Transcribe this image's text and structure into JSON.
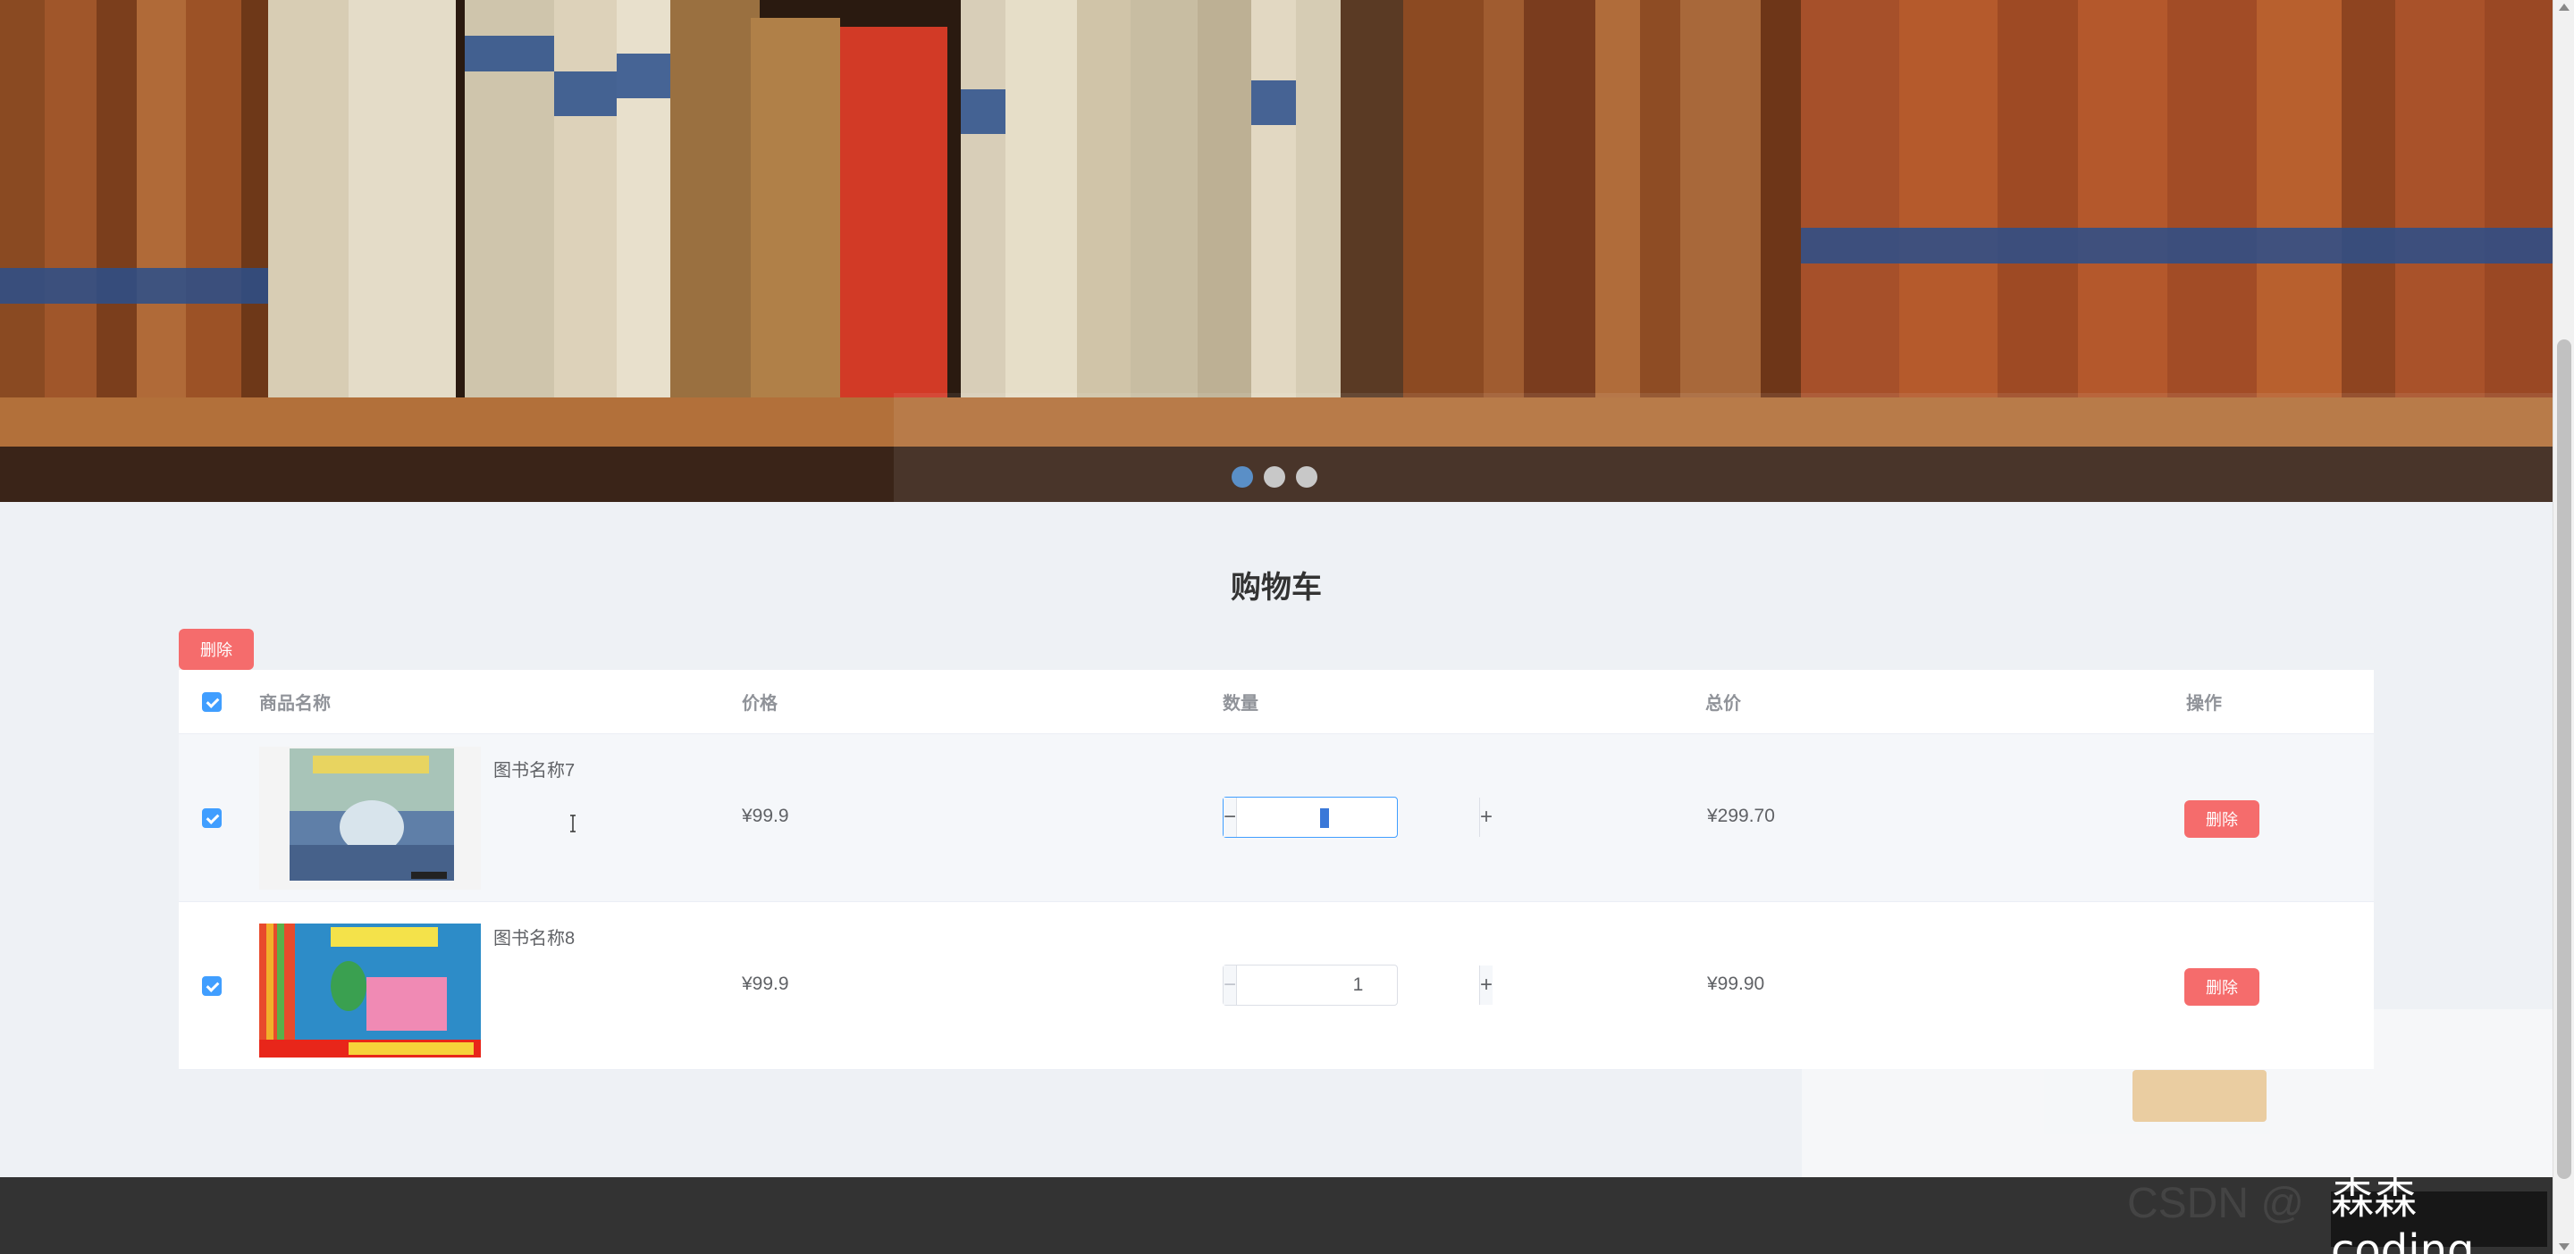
{
  "banner": {
    "slides": 3,
    "active_slide": 1
  },
  "cart": {
    "title": "购物车",
    "bulk_delete_label": "删除",
    "headers": {
      "name": "商品名称",
      "price": "价格",
      "quantity": "数量",
      "total": "总价",
      "action": "操作"
    },
    "items": [
      {
        "name": "图书名称7",
        "price": "¥99.9",
        "quantity": "3",
        "total": "¥299.70",
        "delete_label": "删除",
        "checked": true
      },
      {
        "name": "图书名称8",
        "price": "¥99.9",
        "quantity": "1",
        "total": "¥99.90",
        "delete_label": "删除",
        "checked": true
      }
    ],
    "minus_symbol": "−",
    "plus_symbol": "+"
  },
  "watermark": {
    "text": "森森coding",
    "faded_text": "CSDN @"
  },
  "colors": {
    "danger": "#f56c6c",
    "primary": "#409eff",
    "warning": "#e6a23c",
    "footer": "#333333"
  }
}
